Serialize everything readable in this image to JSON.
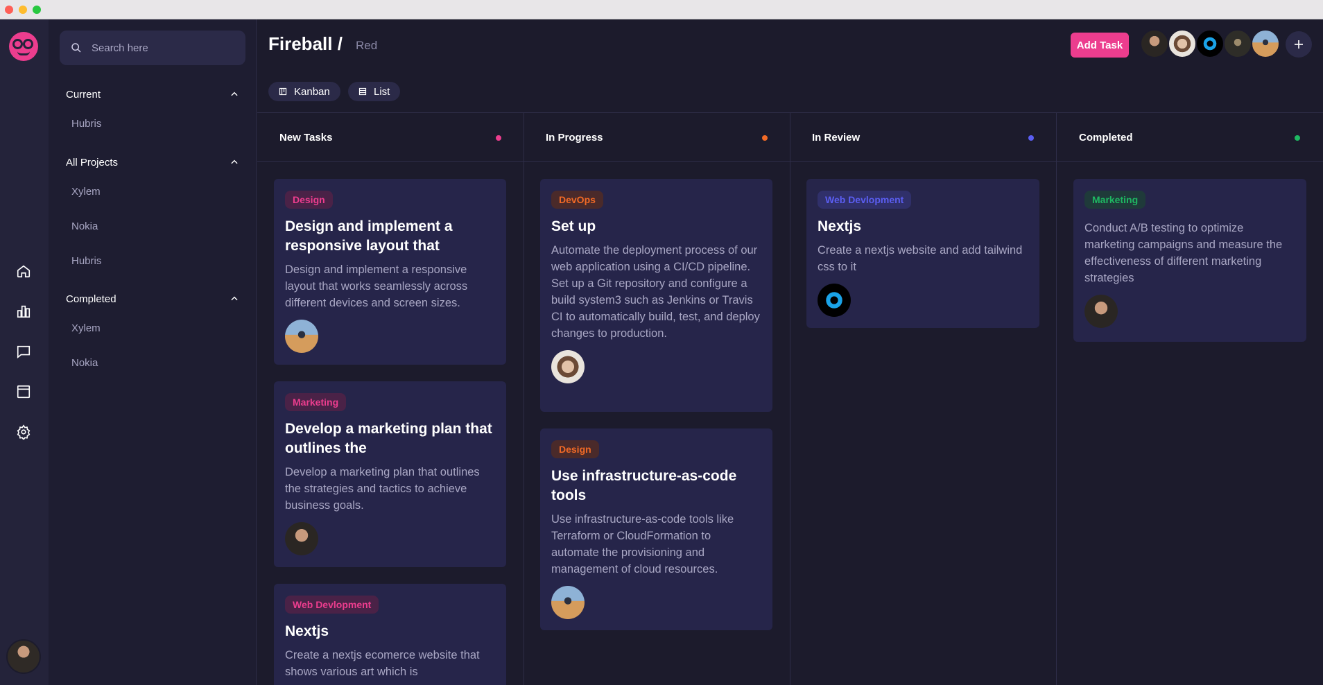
{
  "app": {
    "search": {
      "placeholder": "Search here"
    },
    "colors": {
      "accent": "#ec3d8e",
      "background": "#1c1b2c",
      "card": "#26254a"
    }
  },
  "rail": {
    "icons": [
      "home-icon",
      "chart-icon",
      "chat-icon",
      "calendar-icon",
      "gear-icon"
    ]
  },
  "sidebar": {
    "sections": [
      {
        "title": "Current",
        "items": [
          "Hubris"
        ]
      },
      {
        "title": "All Projects",
        "items": [
          "Xylem",
          "Nokia",
          "Hubris"
        ]
      },
      {
        "title": "Completed",
        "items": [
          "Xylem",
          "Nokia"
        ]
      }
    ]
  },
  "header": {
    "title": "Fireball /",
    "subtitle": "Red",
    "add_task": "Add Task",
    "views": [
      "Kanban",
      "List"
    ]
  },
  "board": {
    "columns": [
      {
        "title": "New Tasks",
        "dot_color": "#ec3d8e",
        "cards": [
          {
            "tag": "Design",
            "title": "Design and implement a responsive layout that",
            "desc": "Design and implement a responsive layout that works seamlessly across different devices and screen sizes."
          },
          {
            "tag": "Marketing",
            "title": "Develop a marketing plan that outlines the",
            "desc": "Develop a marketing plan that outlines the strategies and tactics to achieve business goals."
          },
          {
            "tag": "Web Devlopment",
            "title": "Nextjs",
            "desc": "Create a nextjs ecomerce website that shows various art which is"
          }
        ]
      },
      {
        "title": "In Progress",
        "dot_color": "#f26a26",
        "cards": [
          {
            "tag": "DevOps",
            "title": "Set up",
            "desc": "Automate the deployment process of our web application using a CI/CD pipeline. Set up a Git repository and configure a build system3 such as Jenkins or Travis CI to automatically build, test, and deploy changes to production."
          },
          {
            "tag": "Design",
            "title": "Use infrastructure-as-code tools",
            "desc": "Use infrastructure-as-code tools like Terraform or CloudFormation to automate the provisioning and management of cloud resources."
          }
        ]
      },
      {
        "title": "In Review",
        "dot_color": "#5b5ef2",
        "cards": [
          {
            "tag": "Web Devlopment",
            "title": "Nextjs",
            "desc": "Create a nextjs website and add tailwind css to it"
          }
        ]
      },
      {
        "title": "Completed",
        "dot_color": "#1fb862",
        "cards": [
          {
            "tag": "Marketing",
            "desc": "Conduct A/B testing to optimize marketing campaigns and measure the effectiveness of different marketing strategies"
          }
        ]
      }
    ]
  }
}
